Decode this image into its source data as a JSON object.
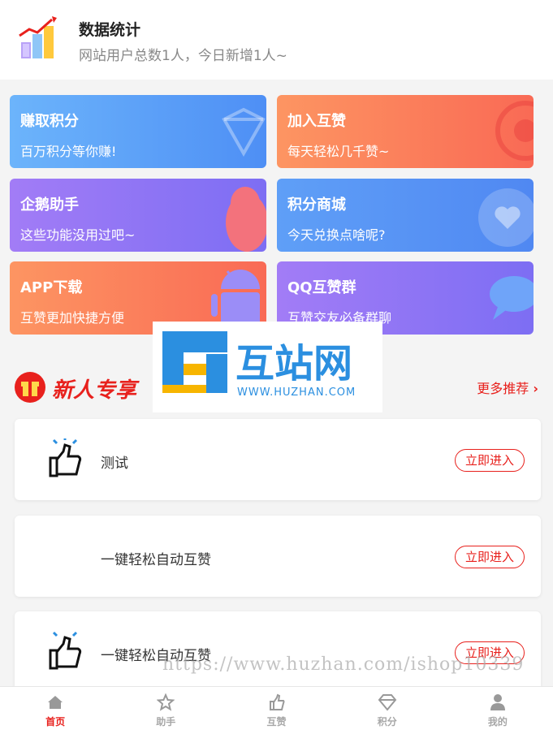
{
  "header": {
    "title": "数据统计",
    "subtitle": "网站用户总数1人，今日新增1人~"
  },
  "cards": [
    {
      "title": "赚取积分",
      "subtitle": "百万积分等你赚!",
      "icon": "diamond-icon"
    },
    {
      "title": "加入互赞",
      "subtitle": "每天轻松几千赞~",
      "icon": "circle-icon"
    },
    {
      "title": "企鹅助手",
      "subtitle": "这些功能没用过吧~",
      "icon": "penguin-icon"
    },
    {
      "title": "积分商城",
      "subtitle": "今天兑换点啥呢?",
      "icon": "heart-icon"
    },
    {
      "title": "APP下载",
      "subtitle": "互赞更加快捷方便",
      "icon": "android-icon"
    },
    {
      "title": "QQ互赞群",
      "subtitle": "互赞交友必备群聊",
      "icon": "chat-icon"
    }
  ],
  "section": {
    "badge": "新人专享",
    "more": "更多推荐"
  },
  "items": [
    {
      "name": "测试",
      "button": "立即进入"
    },
    {
      "name": "一键轻松自动互赞",
      "button": "立即进入"
    },
    {
      "name": "一键轻松自动互赞",
      "button": "立即进入"
    }
  ],
  "watermark": {
    "brand": "互站网",
    "domain": "WWW.HUZHAN.COM",
    "url": "https://www.huzhan.com/ishop10339"
  },
  "tabs": [
    {
      "label": "首页",
      "icon": "home-icon",
      "active": true
    },
    {
      "label": "助手",
      "icon": "star-icon",
      "active": false
    },
    {
      "label": "互赞",
      "icon": "thumbs-up-icon",
      "active": false
    },
    {
      "label": "积分",
      "icon": "diamond-icon",
      "active": false
    },
    {
      "label": "我的",
      "icon": "user-icon",
      "active": false
    }
  ],
  "colors": {
    "accent": "#e8211d",
    "blue": "#4e8ff5",
    "orange": "#f96a55",
    "purple": "#7d6ef3"
  }
}
